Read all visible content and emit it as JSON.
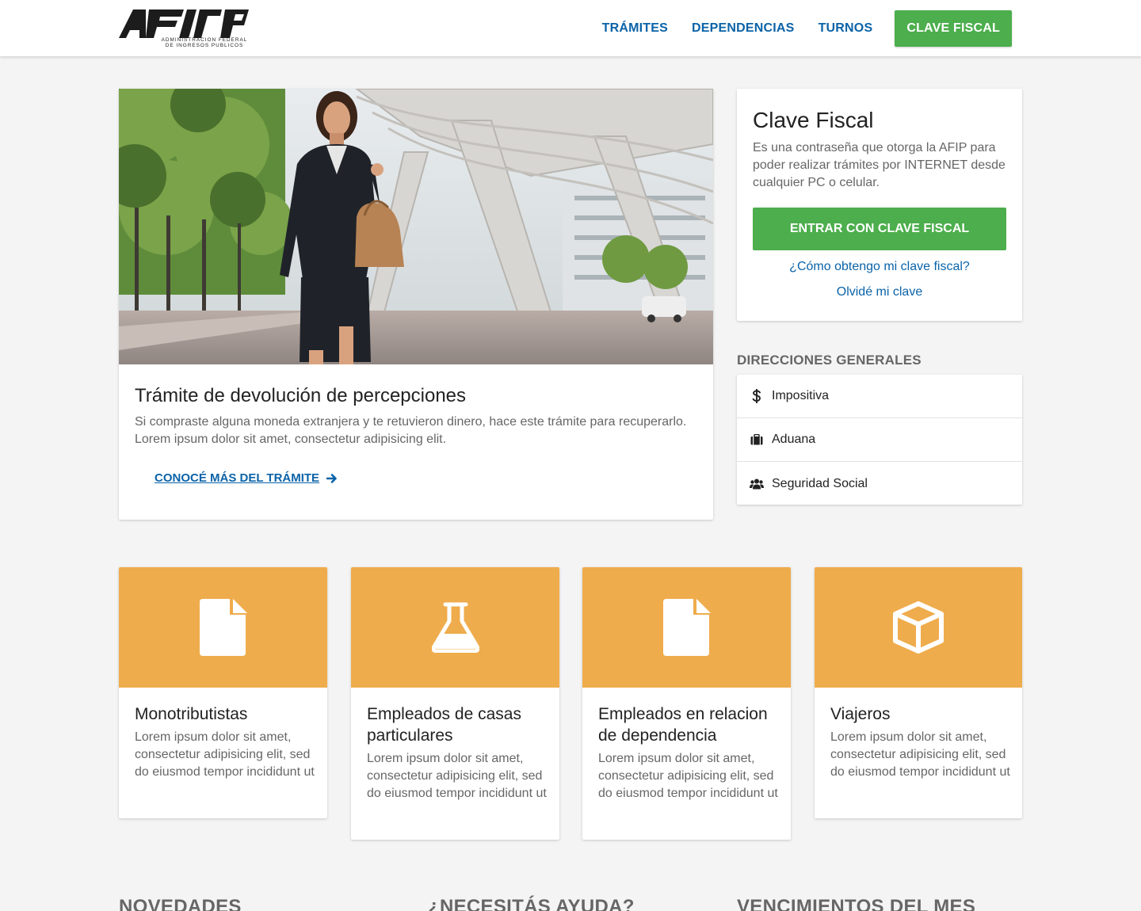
{
  "header": {
    "logo_text": "AFIP",
    "logo_sub1": "ADMINISTRACION FEDERAL",
    "logo_sub2": "DE INGRESOS PUBLICOS",
    "nav": [
      "TRÁMITES",
      "DEPENDENCIAS",
      "TURNOS"
    ],
    "clave_button": "CLAVE FISCAL"
  },
  "hero": {
    "title": "Trámite de devolución de percepciones",
    "text": "Si compraste alguna moneda extranjera y te retuvieron dinero, hace este trámite para recuperarlo. Lorem ipsum dolor sit amet, consectetur adipisicing elit.",
    "link": "CONOCÉ MÁS DEL TRÁMITE"
  },
  "clave": {
    "title": "Clave Fiscal",
    "text": "Es una contraseña que otorga la AFIP para poder realizar trámites por INTERNET desde cualquier PC o celular.",
    "enter_button": "ENTRAR CON CLAVE FISCAL",
    "link_obtain": "¿Cómo obtengo mi clave fiscal?",
    "link_forgot": "Olvidé mi clave"
  },
  "direcciones": {
    "title": "DIRECCIONES GENERALES",
    "items": [
      {
        "label": "Impositiva",
        "icon": "dollar-icon"
      },
      {
        "label": "Aduana",
        "icon": "briefcase-icon"
      },
      {
        "label": "Seguridad Social",
        "icon": "users-icon"
      }
    ]
  },
  "categories": [
    {
      "title": "Monotributistas",
      "text": "Lorem ipsum dolor sit amet, consectetur adipisicing elit, sed do eiusmod tempor incididunt ut",
      "icon": "file-icon"
    },
    {
      "title": "Empleados de casas particulares",
      "text": "Lorem ipsum dolor sit amet, consectetur adipisicing elit, sed do eiusmod tempor incididunt ut",
      "icon": "flask-icon"
    },
    {
      "title": "Empleados en relacion de dependencia",
      "text": "Lorem ipsum dolor sit amet, consectetur adipisicing elit, sed do eiusmod tempor incididunt ut",
      "icon": "file-icon"
    },
    {
      "title": "Viajeros",
      "text": "Lorem ipsum dolor sit amet, consectetur adipisicing elit, sed do eiusmod tempor incididunt ut",
      "icon": "cube-icon"
    }
  ],
  "bottom_sections": [
    "NOVEDADES",
    "¿NECESITÁS AYUDA?",
    "VENCIMIENTOS DEL MES"
  ],
  "colors": {
    "link": "#0b63a8",
    "green": "#4cae4c",
    "orange": "#efac4c",
    "background": "#f4f4f4"
  }
}
